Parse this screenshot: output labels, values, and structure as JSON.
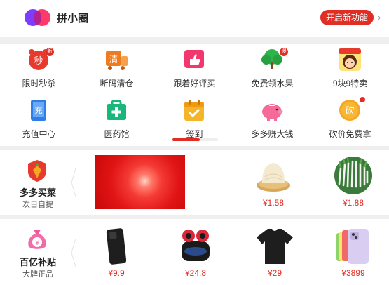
{
  "header": {
    "title": "拼小圈",
    "open_button": "开启新功能"
  },
  "grid": {
    "row1": [
      {
        "label": "限时秒杀",
        "icon": "alarm-clock-sec-icon",
        "glyph": "秒"
      },
      {
        "label": "断码清仓",
        "icon": "clearance-truck-icon",
        "glyph": "清"
      },
      {
        "label": "跟着好评买",
        "icon": "thumbs-up-icon",
        "glyph": ""
      },
      {
        "label": "免费领水果",
        "icon": "fruit-tree-icon",
        "glyph": ""
      },
      {
        "label": "9块9特卖",
        "icon": "girl-avatar-icon",
        "glyph": ""
      }
    ],
    "row2": [
      {
        "label": "充值中心",
        "icon": "phone-recharge-icon",
        "glyph": "充"
      },
      {
        "label": "医药馆",
        "icon": "medicine-kit-icon",
        "glyph": ""
      },
      {
        "label": "签到",
        "icon": "calendar-check-icon",
        "glyph": ""
      },
      {
        "label": "多多赚大钱",
        "icon": "piggy-bank-icon",
        "glyph": ""
      },
      {
        "label": "砍价免费拿",
        "icon": "bargain-coin-icon",
        "glyph": "砍"
      }
    ],
    "scroll_progress": 0.6
  },
  "grocery": {
    "title": "多多买菜",
    "subtitle": "次日自提",
    "products": [
      {
        "name": "dried-noodles",
        "price": "¥1.58"
      },
      {
        "name": "green-onions",
        "price": "¥1.88"
      }
    ]
  },
  "subsidy": {
    "title": "百亿补贴",
    "subtitle": "大牌正品",
    "products": [
      {
        "name": "smartphone",
        "price": "¥9.9"
      },
      {
        "name": "wireless-earbuds",
        "price": "¥24.8"
      },
      {
        "name": "black-tshirt",
        "price": "¥29"
      },
      {
        "name": "iphone",
        "price": "¥3899"
      }
    ]
  },
  "colors": {
    "accent": "#e02e24",
    "price": "#e02e24"
  }
}
